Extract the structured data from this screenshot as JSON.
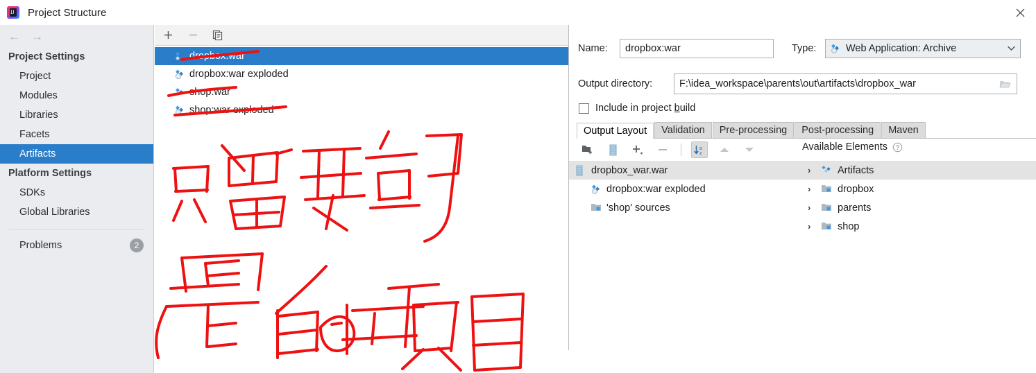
{
  "window": {
    "title": "Project Structure",
    "app_icon": "intellij-idea-icon",
    "close_label": "✕"
  },
  "sidebar": {
    "nav": {
      "back": "←",
      "forward": "→"
    },
    "groups": [
      {
        "label": "Project Settings",
        "items": [
          {
            "label": "Project",
            "selected": false
          },
          {
            "label": "Modules",
            "selected": false
          },
          {
            "label": "Libraries",
            "selected": false
          },
          {
            "label": "Facets",
            "selected": false
          },
          {
            "label": "Artifacts",
            "selected": true
          }
        ]
      },
      {
        "label": "Platform Settings",
        "items": [
          {
            "label": "SDKs",
            "selected": false
          },
          {
            "label": "Global Libraries",
            "selected": false
          }
        ]
      }
    ],
    "problems": {
      "label": "Problems",
      "count": "2"
    }
  },
  "artifacts_panel": {
    "toolbar": [
      {
        "name": "add-artifact-button",
        "glyph": "+"
      },
      {
        "name": "remove-artifact-button",
        "glyph": "−"
      },
      {
        "name": "copy-artifact-button",
        "glyph": "copy-icon"
      }
    ],
    "items": [
      {
        "label": "dropbox:war",
        "icon": "web-archive-icon",
        "selected": true
      },
      {
        "label": "dropbox:war exploded",
        "icon": "web-exploded-icon",
        "selected": false
      },
      {
        "label": "shop:war",
        "icon": "web-archive-icon",
        "selected": false
      },
      {
        "label": "shop:war exploded",
        "icon": "web-exploded-icon",
        "selected": false
      }
    ]
  },
  "details": {
    "name_label": "Name:",
    "name_value": "dropbox:war",
    "type_label": "Type:",
    "type_value": "Web Application: Archive",
    "type_icon": "web-archive-icon",
    "output_label": "Output directory:",
    "output_value": "F:\\idea_workspace\\parents\\out\\artifacts\\dropbox_war",
    "browse_icon": "folder-browse-icon",
    "include_checkbox": {
      "label_before": "Include in project ",
      "label_mnemonic": "b",
      "label_after": "uild",
      "checked": false
    },
    "tabs": [
      {
        "label": "Output Layout",
        "active": true
      },
      {
        "label": "Validation",
        "active": false
      },
      {
        "label": "Pre-processing",
        "active": false
      },
      {
        "label": "Post-processing",
        "active": false
      },
      {
        "label": "Maven",
        "active": false
      }
    ],
    "layout_toolbar": [
      {
        "name": "add-directory-button",
        "icon": "folder-add-icon"
      },
      {
        "name": "add-archive-button",
        "icon": "archive-icon"
      },
      {
        "name": "add-element-button",
        "icon": "plus-dropdown-icon"
      },
      {
        "name": "remove-element-button",
        "icon": "minus-icon"
      },
      {
        "name": "sort-alphabetically-button",
        "icon": "sort-az-icon",
        "toggled": true
      },
      {
        "name": "move-up-button",
        "icon": "arrow-up-icon"
      },
      {
        "name": "move-down-button",
        "icon": "arrow-down-icon"
      }
    ],
    "layout_tree": [
      {
        "label": "dropbox_war.war",
        "icon": "archive-icon",
        "indent": 0,
        "selected": true
      },
      {
        "label": "dropbox:war exploded",
        "icon": "web-exploded-icon",
        "indent": 1,
        "selected": false
      },
      {
        "label": "'shop' sources",
        "icon": "source-folder-icon",
        "indent": 1,
        "selected": false
      }
    ],
    "available": {
      "title": "Available Elements",
      "help_icon": "help-icon",
      "items": [
        {
          "label": "Artifacts",
          "icon": "artifacts-icon",
          "chevron": "›",
          "selected": true
        },
        {
          "label": "dropbox",
          "icon": "module-folder-icon",
          "chevron": "›",
          "selected": false
        },
        {
          "label": "parents",
          "icon": "module-folder-icon",
          "chevron": "›",
          "selected": false
        },
        {
          "label": "shop",
          "icon": "module-folder-icon",
          "chevron": "›",
          "selected": false
        }
      ]
    }
  },
  "annotation": {
    "color": "#ee1111",
    "handwriting_text": "只留要部署的项目",
    "strikethrough_targets": [
      "dropbox:war",
      "shop:war",
      "shop:war exploded"
    ]
  }
}
